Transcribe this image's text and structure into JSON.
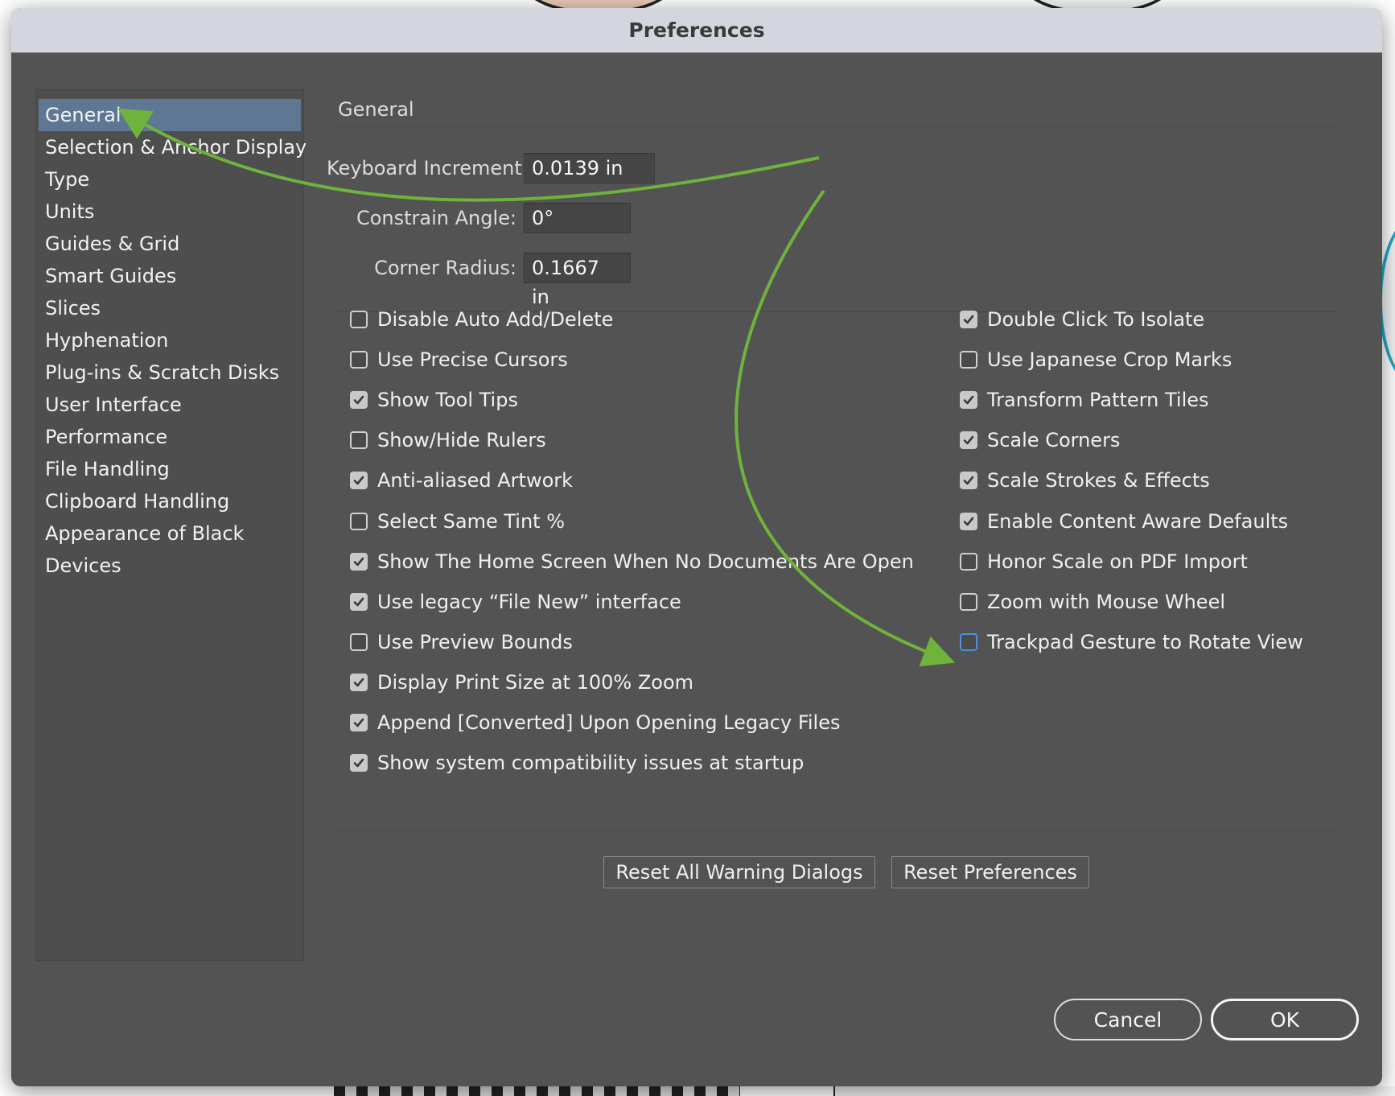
{
  "dialog": {
    "title": "Preferences"
  },
  "sidebar": {
    "items": [
      {
        "label": "General",
        "selected": true
      },
      {
        "label": "Selection & Anchor Display"
      },
      {
        "label": "Type"
      },
      {
        "label": "Units"
      },
      {
        "label": "Guides & Grid"
      },
      {
        "label": "Smart Guides"
      },
      {
        "label": "Slices"
      },
      {
        "label": "Hyphenation"
      },
      {
        "label": "Plug-ins & Scratch Disks"
      },
      {
        "label": "User Interface"
      },
      {
        "label": "Performance"
      },
      {
        "label": "File Handling"
      },
      {
        "label": "Clipboard Handling"
      },
      {
        "label": "Appearance of Black"
      },
      {
        "label": "Devices"
      }
    ]
  },
  "general": {
    "section_title": "General",
    "fields": {
      "keyboard_increment": {
        "label": "Keyboard Increment:",
        "value": "0.0139 in"
      },
      "constrain_angle": {
        "label": "Constrain Angle:",
        "value": "0°"
      },
      "corner_radius": {
        "label": "Corner Radius:",
        "value": "0.1667 in"
      }
    },
    "left_options": [
      {
        "label": "Disable Auto Add/Delete",
        "checked": false
      },
      {
        "label": "Use Precise Cursors",
        "checked": false
      },
      {
        "label": "Show Tool Tips",
        "checked": true
      },
      {
        "label": "Show/Hide Rulers",
        "checked": false
      },
      {
        "label": "Anti-aliased Artwork",
        "checked": true
      },
      {
        "label": "Select Same Tint %",
        "checked": false
      },
      {
        "label": "Show The Home Screen When No Documents Are Open",
        "checked": true
      },
      {
        "label": "Use legacy “File New” interface",
        "checked": true
      },
      {
        "label": "Use Preview Bounds",
        "checked": false
      },
      {
        "label": "Display Print Size at 100% Zoom",
        "checked": true
      },
      {
        "label": "Append [Converted] Upon Opening Legacy Files",
        "checked": true
      },
      {
        "label": "Show system compatibility issues at startup",
        "checked": true
      }
    ],
    "right_options": [
      {
        "label": "Double Click To Isolate",
        "checked": true
      },
      {
        "label": "Use Japanese Crop Marks",
        "checked": false
      },
      {
        "label": "Transform Pattern Tiles",
        "checked": true
      },
      {
        "label": "Scale Corners",
        "checked": true
      },
      {
        "label": "Scale Strokes & Effects",
        "checked": true
      },
      {
        "label": "Enable Content Aware Defaults",
        "checked": true
      },
      {
        "label": "Honor Scale on PDF Import",
        "checked": false
      },
      {
        "label": "Zoom with Mouse Wheel",
        "checked": false
      },
      {
        "label": "Trackpad Gesture to Rotate View",
        "checked": false,
        "focused": true
      }
    ],
    "buttons": {
      "reset_warnings": "Reset All Warning Dialogs",
      "reset_preferences": "Reset Preferences"
    }
  },
  "footer": {
    "cancel": "Cancel",
    "ok": "OK"
  },
  "colors": {
    "dialog_bg": "#535353",
    "selection": "#5e7793",
    "annotation_arrow": "#6fb33c",
    "focus_ring": "#4d90e0"
  }
}
